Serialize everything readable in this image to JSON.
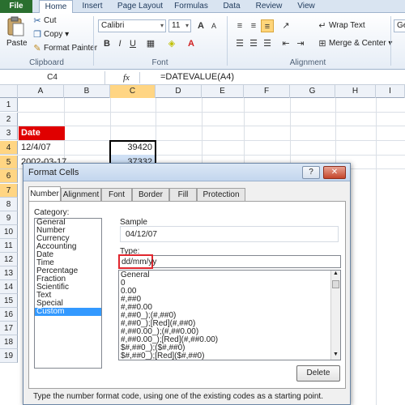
{
  "ribbon": {
    "tabs": [
      "File",
      "Home",
      "Insert",
      "Page Layout",
      "Formulas",
      "Data",
      "Review",
      "View"
    ],
    "clipboard": {
      "paste": "Paste",
      "cut": "Cut",
      "copy": "Copy ▾",
      "format_painter": "Format Painter",
      "label": "Clipboard"
    },
    "font": {
      "name": "Calibri",
      "size": "11",
      "label": "Font",
      "bold": "B",
      "italic": "I",
      "underline": "U",
      "grow": "A",
      "shrink": "A"
    },
    "alignment": {
      "wrap_text": "Wrap Text",
      "merge_center": "Merge & Center ▾",
      "label": "Alignment"
    },
    "number_format_partial": "Ge"
  },
  "formula_bar": {
    "name_box": "C4",
    "fx": "fx",
    "formula": "=DATEVALUE(A4)"
  },
  "sheet": {
    "columns": [
      "A",
      "B",
      "C",
      "D",
      "E",
      "F",
      "G",
      "H",
      "I"
    ],
    "rows": [
      "1",
      "2",
      "3",
      "4",
      "5",
      "6",
      "7",
      "8",
      "9",
      "10",
      "11",
      "12",
      "13",
      "14",
      "15",
      "16",
      "17",
      "18",
      "19"
    ],
    "a3": "Date",
    "a4": "12/4/07",
    "a5": "2002-03-17",
    "c4": "39420",
    "c5": "37332"
  },
  "dialog": {
    "title": "Format Cells",
    "help": "?",
    "close": "✕",
    "tabs": [
      "Number",
      "Alignment",
      "Font",
      "Border",
      "Fill",
      "Protection"
    ],
    "category_label": "Category:",
    "categories": [
      "General",
      "Number",
      "Currency",
      "Accounting",
      "Date",
      "Time",
      "Percentage",
      "Fraction",
      "Scientific",
      "Text",
      "Special",
      "Custom"
    ],
    "selected_category": "Custom",
    "sample_label": "Sample",
    "sample_value": "04/12/07",
    "type_label": "Type:",
    "type_value": "dd/mm/yy",
    "formats": [
      "General",
      "0",
      "0.00",
      "#,##0",
      "#,##0.00",
      "#,##0_);(#,##0)",
      "#,##0_);[Red](#,##0)",
      "#,##0.00_);(#,##0.00)",
      "#,##0.00_);[Red](#,##0.00)",
      "$#,##0_);($#,##0)",
      "$#,##0_);[Red]($#,##0)"
    ],
    "delete_button": "Delete",
    "hint": "Type the number format code, using one of the existing codes as a starting point."
  },
  "colors": {
    "file_tab": "#2a6f2f",
    "date_header_fill": "#e00000",
    "selected_header": "#ffd583",
    "type_highlight": "#e0262e",
    "list_selection": "#3399ff"
  }
}
